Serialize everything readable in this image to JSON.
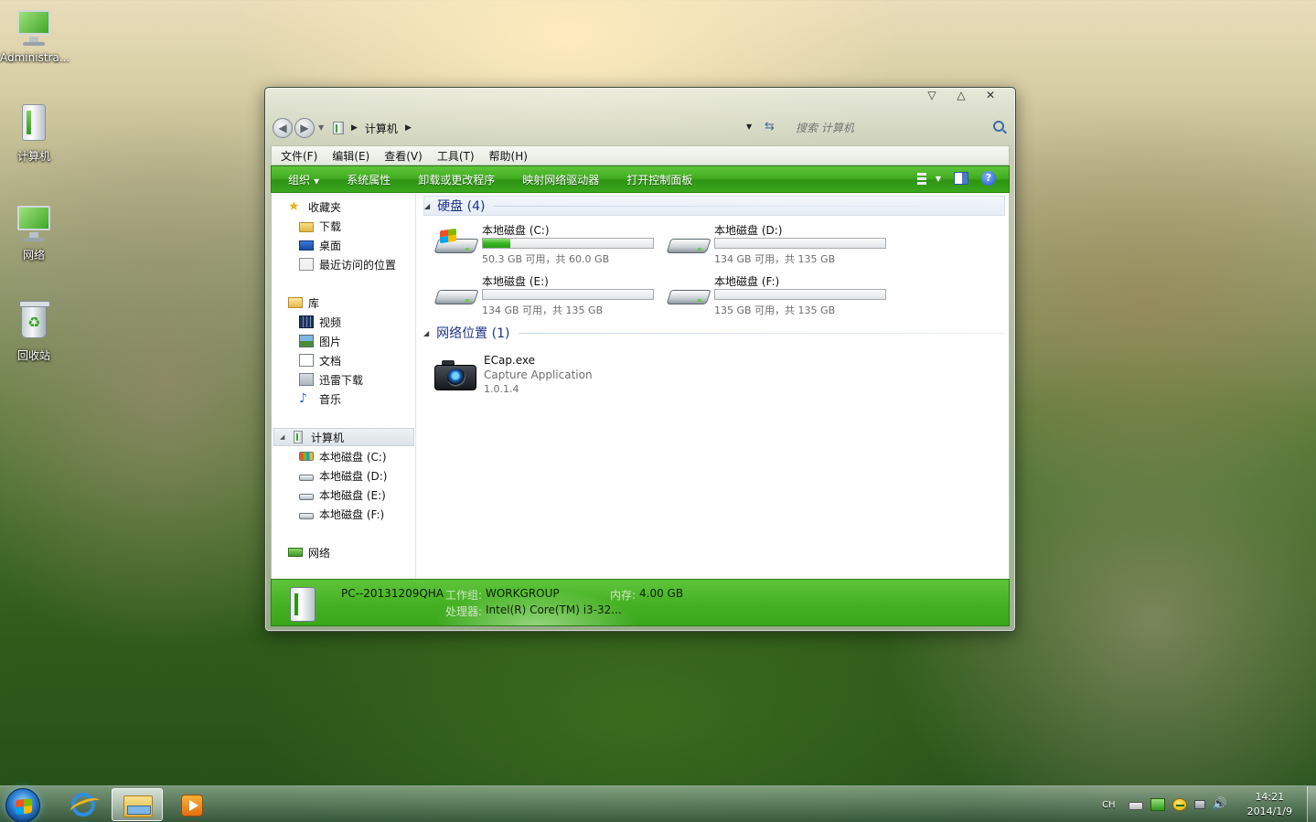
{
  "desktop": {
    "icons": [
      {
        "label": "Administra..."
      },
      {
        "label": "计算机"
      },
      {
        "label": "网络"
      },
      {
        "label": "回收站"
      }
    ]
  },
  "window": {
    "caption_buttons": {
      "dropdown": "▽",
      "up": "△",
      "close": "✕"
    },
    "address": {
      "crumb": "计算机"
    },
    "search": {
      "placeholder": "搜索 计算机"
    },
    "menu": [
      "文件(F)",
      "编辑(E)",
      "查看(V)",
      "工具(T)",
      "帮助(H)"
    ],
    "toolbar": [
      "组织",
      "系统属性",
      "卸载或更改程序",
      "映射网络驱动器",
      "打开控制面板"
    ],
    "nav": {
      "favorites": {
        "label": "收藏夹",
        "items": [
          "下载",
          "桌面",
          "最近访问的位置"
        ]
      },
      "libraries": {
        "label": "库",
        "items": [
          "视频",
          "图片",
          "文档",
          "迅雷下载",
          "音乐"
        ]
      },
      "computer": {
        "label": "计算机",
        "items": [
          "本地磁盘 (C:)",
          "本地磁盘 (D:)",
          "本地磁盘 (E:)",
          "本地磁盘 (F:)"
        ]
      },
      "network": {
        "label": "网络"
      }
    },
    "groups": {
      "hdd": {
        "title": "硬盘 (4)"
      },
      "net": {
        "title": "网络位置 (1)"
      }
    },
    "drives": [
      {
        "name": "本地磁盘 (C:)",
        "free": "50.3 GB 可用，共 60.0 GB",
        "used_fraction": 0.16,
        "system": true
      },
      {
        "name": "本地磁盘 (D:)",
        "free": "134 GB 可用，共 135 GB",
        "used_fraction": 0.0,
        "system": false
      },
      {
        "name": "本地磁盘 (E:)",
        "free": "134 GB 可用，共 135 GB",
        "used_fraction": 0.0,
        "system": false
      },
      {
        "name": "本地磁盘 (F:)",
        "free": "135 GB 可用，共 135 GB",
        "used_fraction": 0.0,
        "system": false
      }
    ],
    "network_item": {
      "name": "ECap.exe",
      "desc": "Capture Application",
      "version": "1.0.1.4"
    },
    "details": {
      "pc_name": "PC--20131209QHA",
      "workgroup_label": "工作组:",
      "workgroup": "WORKGROUP",
      "memory_label": "内存:",
      "memory": "4.00 GB",
      "cpu_label": "处理器:",
      "cpu": "Intel(R) Core(TM) i3-32..."
    }
  },
  "taskbar": {
    "lang": "CH",
    "time": "14:21",
    "date": "2014/1/9"
  },
  "colors": {
    "accent_green": "#42ad21",
    "group_header": "#1e3287",
    "drive_fill": "#34b21f"
  }
}
